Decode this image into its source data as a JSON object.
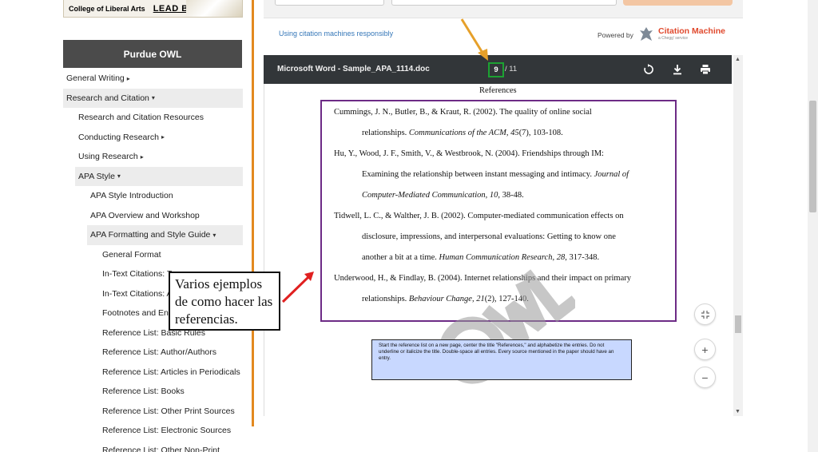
{
  "logo": {
    "text": "College of Liberal Arts",
    "tagline": "LEAD BOLDLY."
  },
  "sidebar": {
    "header": "Purdue OWL",
    "items": [
      {
        "label": "General Writing",
        "level": 0,
        "caret": "▸",
        "selected": false
      },
      {
        "label": "Research and Citation",
        "level": 0,
        "caret": "▾",
        "selected": true
      },
      {
        "label": "Research and Citation Resources",
        "level": 1,
        "caret": "",
        "selected": false
      },
      {
        "label": "Conducting Research",
        "level": 1,
        "caret": "▸",
        "selected": false
      },
      {
        "label": "Using Research",
        "level": 1,
        "caret": "▸",
        "selected": false
      },
      {
        "label": "APA Style",
        "level": 1,
        "caret": "▾",
        "selected": true
      },
      {
        "label": "APA Style Introduction",
        "level": 2,
        "caret": "",
        "selected": false
      },
      {
        "label": "APA Overview and Workshop",
        "level": 2,
        "caret": "",
        "selected": false
      },
      {
        "label": "APA Formatting and Style Guide",
        "level": 2,
        "caret": "▾",
        "selected": true
      },
      {
        "label": "General Format",
        "level": 3,
        "caret": "",
        "selected": false
      },
      {
        "label": "In-Text Citations: T",
        "level": 3,
        "caret": "",
        "selected": false
      },
      {
        "label": "In-Text Citations: A",
        "level": 3,
        "caret": "",
        "selected": false
      },
      {
        "label": "Footnotes and End",
        "level": 3,
        "caret": "",
        "selected": false
      },
      {
        "label": "Reference List: Basic Rules",
        "level": 3,
        "caret": "",
        "selected": false
      },
      {
        "label": "Reference List: Author/Authors",
        "level": 3,
        "caret": "",
        "selected": false
      },
      {
        "label": "Reference List: Articles in Periodicals",
        "level": 3,
        "caret": "",
        "selected": false
      },
      {
        "label": "Reference List: Books",
        "level": 3,
        "caret": "",
        "selected": false
      },
      {
        "label": "Reference List: Other Print Sources",
        "level": 3,
        "caret": "",
        "selected": false
      },
      {
        "label": "Reference List: Electronic Sources",
        "level": 3,
        "caret": "",
        "selected": false
      },
      {
        "label": "Reference List: Other Non-Print",
        "level": 3,
        "caret": "",
        "selected": false
      }
    ]
  },
  "citation": {
    "link": "Using citation machines responsibly",
    "powered_by": "Powered by",
    "brand": "Citation Machine",
    "brand_sub": "a Chegg' service"
  },
  "pdf": {
    "title": "Microsoft Word - Sample_APA_1114.doc",
    "page_current": "9",
    "page_total": "/ 11",
    "icons": [
      "rotate-icon",
      "download-icon",
      "print-icon"
    ],
    "heading": "References",
    "lines": [
      {
        "indent": false,
        "html": "Cummings, J. N., Butler, B., &amp; Kraut, R. (2002). The quality of online social"
      },
      {
        "indent": true,
        "html": "relationships. <i>Communications of the ACM, 45</i>(7), 103-108."
      },
      {
        "indent": false,
        "html": "Hu, Y., Wood, J. F., Smith, V., &amp; Westbrook, N. (2004). Friendships through IM:"
      },
      {
        "indent": true,
        "html": "Examining the relationship between instant messaging and intimacy. <i>Journal of</i>"
      },
      {
        "indent": true,
        "html": "<i>Computer-Mediated Communication, 10</i>, 38-48."
      },
      {
        "indent": false,
        "html": "Tidwell, L. C., &amp; Walther, J. B. (2002). Computer-mediated communication effects on"
      },
      {
        "indent": true,
        "html": "disclosure, impressions, and interpersonal evaluations: Getting to know one"
      },
      {
        "indent": true,
        "html": "another a bit at a time. <i>Human Communication Research, 28</i>, 317-348."
      },
      {
        "indent": false,
        "html": "Underwood, H., &amp; Findlay, B. (2004). Internet relationships and their impact on primary"
      },
      {
        "indent": true,
        "html": "relationships. <i>Behaviour Change, 21</i>(2), 127-140."
      }
    ],
    "instructions": "Start the reference list on a new page, center the title \"References,\" and alphabetize the entries.  Do not underline or italicize the title.  Double-space all entries.  Every source mentioned in the paper should have an entry.",
    "watermark": "OWL"
  },
  "annotation": "Varios ejemplos de como hacer las referencias.",
  "colors": {
    "accent_orange": "#e3891f",
    "frame_purple": "#6d2b86",
    "arrow_red": "#e02020",
    "page_green": "#1ca232"
  }
}
